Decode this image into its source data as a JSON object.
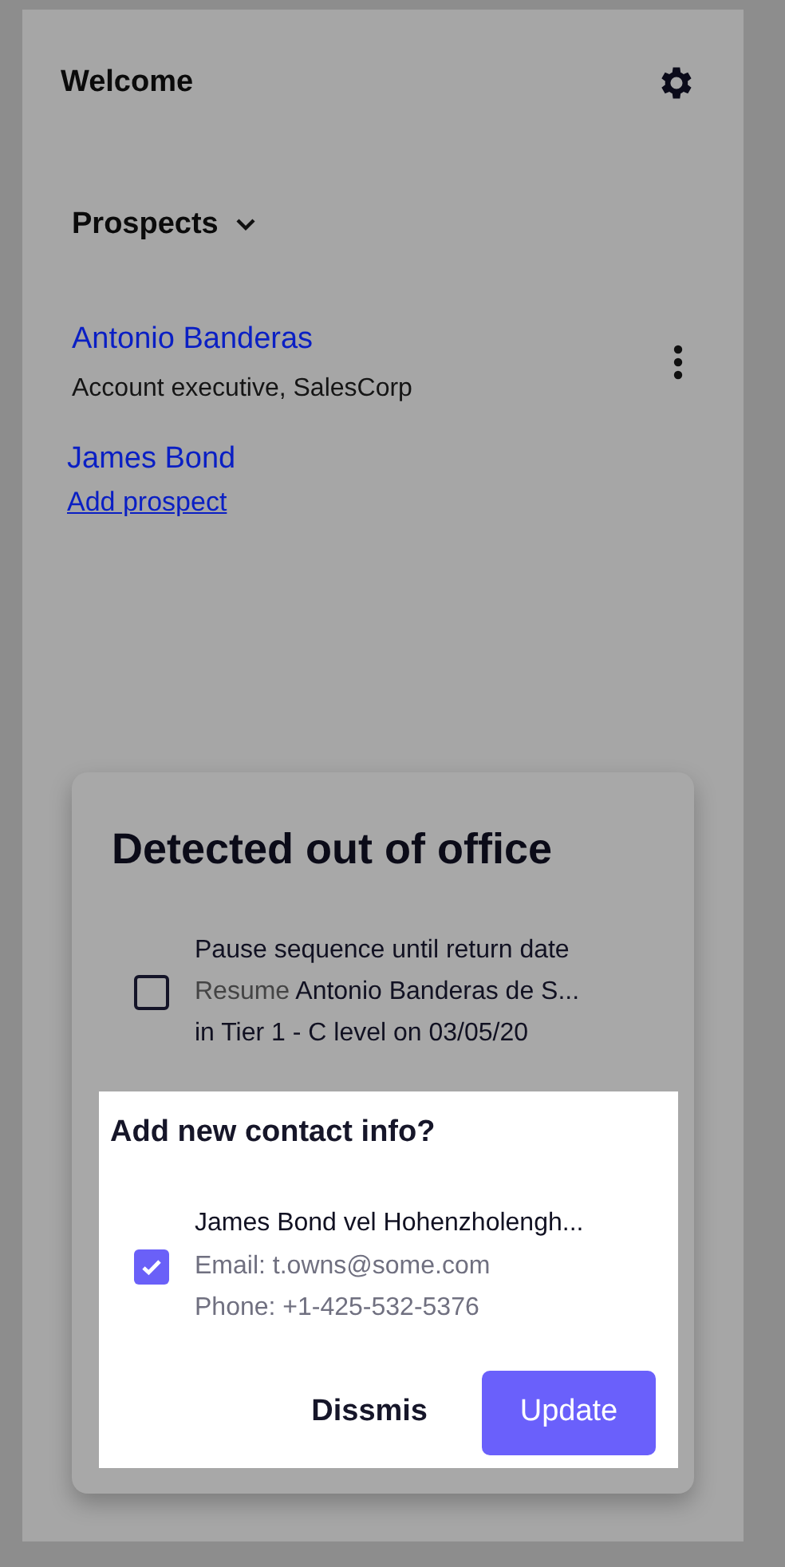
{
  "header": {
    "title": "Welcome"
  },
  "section": {
    "title": "Prospects",
    "expanded": false
  },
  "prospects": [
    {
      "name": "Antonio Banderas",
      "subtitle": "Account executive, SalesCorp",
      "has_menu": true
    },
    {
      "name": "James Bond",
      "has_menu": false
    }
  ],
  "add_link": "Add prospect",
  "dialog": {
    "title": "Detected out of office",
    "pause_option": {
      "checked": false,
      "title": "Pause sequence until return date",
      "prefix": "Resume",
      "name": "Antonio Banderas de S...",
      "detail": "in Tier 1 - C level on 03/05/20"
    },
    "contact_section": {
      "title": "Add new contact info?",
      "checked": true,
      "name": "James Bond vel Hohenzholengh...",
      "email": "Email: t.owns@some.com",
      "phone": "Phone: +1-425-532-5376"
    },
    "buttons": [
      {
        "label": "Dissmis",
        "kind": "text"
      },
      {
        "label": "Update",
        "kind": "primary"
      }
    ]
  }
}
